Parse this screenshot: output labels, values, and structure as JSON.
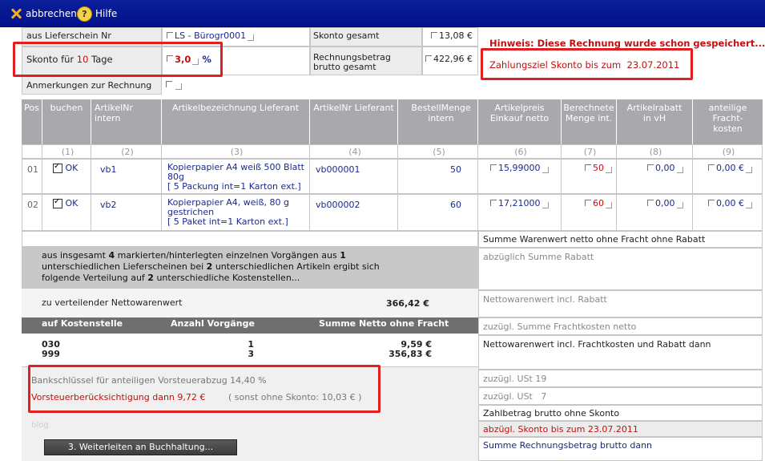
{
  "toolbar": {
    "cancel_label": "abbrechen",
    "help_label": "Hilfe",
    "help_glyph": "?"
  },
  "header": {
    "delivery_label": "aus Lieferschein Nr",
    "delivery_value": "LS - Bürogr0001",
    "skonto_total_label": "Skonto gesamt",
    "skonto_total_value": "13,08 €",
    "skonto_days_pre": "Skonto für ",
    "skonto_days_num": "10",
    "skonto_days_post": " Tage",
    "skonto_pct_value": "3,0",
    "skonto_pct_unit": "%",
    "gross_label_1": "Rechnungsbetrag",
    "gross_label_2": "brutto gesamt",
    "gross_value": "422,96 €",
    "notes_label": "Anmerkungen zur Rechnung",
    "hint_text": "Hinweis: Diese Rechnung wurde schon gespeichert....",
    "deadline_label": "Zahlungsziel Skonto bis zum",
    "deadline_date": "23.07.2011"
  },
  "table": {
    "columns": [
      {
        "label": "Pos",
        "index": ""
      },
      {
        "label": "buchen",
        "index": "(1)"
      },
      {
        "label": "ArtikelNr intern",
        "index": "(2)"
      },
      {
        "label": "Artikelbezeichnung Lieferant",
        "index": "(3)"
      },
      {
        "label": "ArtikelNr Lieferant",
        "index": "(4)"
      },
      {
        "label": "BestellMenge intern",
        "index": "(5)"
      },
      {
        "label": "Artikelpreis Einkauf netto",
        "index": "(6)"
      },
      {
        "label": "Berechnete Menge int.",
        "index": "(7)"
      },
      {
        "label": "Artikelrabatt in vH",
        "index": "(8)"
      },
      {
        "label": "anteilige Fracht-kosten",
        "index": "(9)"
      }
    ],
    "rows": [
      {
        "pos": "01",
        "status": "OK",
        "art_int": "vb1",
        "desc": "Kopierpapier A4 weiß 500 Blatt 80g",
        "pack": "[ 5 Packung int=1 Karton ext.]",
        "art_sup": "vb000001",
        "qty": "50",
        "price": "15,99000",
        "calc_qty": "50",
        "rebate": "0,00",
        "freight": "0,00 €"
      },
      {
        "pos": "02",
        "status": "OK",
        "art_int": "vb2",
        "desc": "Kopierpapier A4, weiß, 80 g gestrichen",
        "pack": "[ 5 Paket int=1 Karton ext.]",
        "art_sup": "vb000002",
        "qty": "60",
        "price": "17,21000",
        "calc_qty": "60",
        "rebate": "0,00",
        "freight": "0,00 €"
      }
    ]
  },
  "distribution": {
    "s1": "aus insgesamt ",
    "n1": "4",
    "s2": " markierten/hinterlegten einzelnen Vorgängen aus ",
    "n2": "1",
    "s3": "unterschiedlichen Lieferscheinen bei ",
    "n3": "2",
    "s4": " unterschiedlichen Artikeln ergibt sich",
    "s5": "folgende Verteilung auf ",
    "n4": "2",
    "s6": " unterschiedliche Kostenstellen...",
    "net_label": "zu verteilender Nettowarenwert",
    "net_value": "366,42 €",
    "head_cost": "auf Kostenstelle",
    "head_count": "Anzahl Vorgänge",
    "head_sum": "Summe Netto ohne Fracht",
    "cost_rows": [
      {
        "center": "030",
        "count": "1",
        "sum": "9,59 €"
      },
      {
        "center": "999",
        "count": "3",
        "sum": "356,83 €"
      }
    ],
    "bank_key": "Bankschlüssel für anteiligen Vorsteuerabzug 14,40 %",
    "tax_label": "Vorsteuerberücksichtigung dann 9,72 €",
    "tax_note": "( sonst ohne Skonto: 10,03 € )",
    "blog": "blog",
    "forward_button": "3. Weiterleiten an Buchhaltung..."
  },
  "summary": [
    {
      "label": "Summe Warenwert netto ohne Fracht ohne Rabatt"
    },
    {
      "label": "abzüglich Summe Rabatt"
    },
    {
      "label": "Nettowarenwert incl. Rabatt"
    },
    {
      "label": "zuzügl. Summe Frachtkosten netto"
    },
    {
      "label": "Nettowarenwert incl. Frachtkosten und Rabatt dann"
    },
    {
      "label": "zuzügl. USt 19"
    },
    {
      "label": "zuzügl. USt   7"
    },
    {
      "label": "Zahlbetrag brutto ohne Skonto"
    },
    {
      "label": "abzügl. Skonto bis zum 23.07.2011"
    },
    {
      "label": "Summe Rechnungsbetrag brutto dann"
    }
  ]
}
